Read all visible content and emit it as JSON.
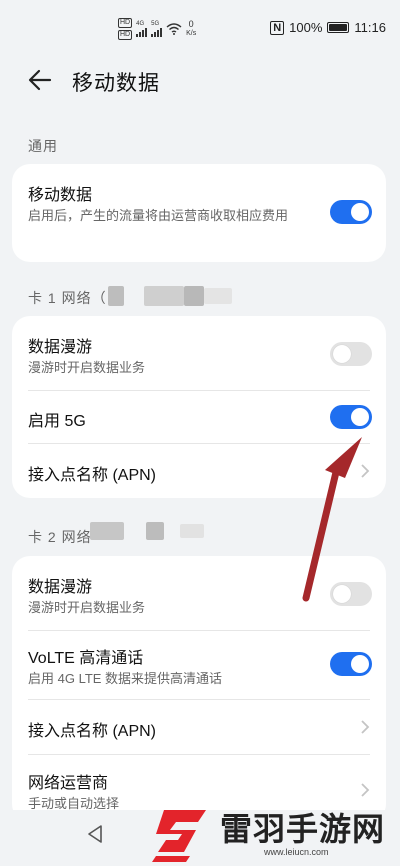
{
  "status_bar": {
    "speed_value": "0",
    "speed_unit": "K/s",
    "battery_percent": "100%",
    "time": "11:16",
    "network_types": [
      "HD",
      "HD",
      "4G",
      "5G"
    ]
  },
  "header": {
    "title": "移动数据"
  },
  "sections": {
    "general_label": "通用",
    "sim1_label": "卡 1 网络（",
    "sim2_label": "卡 2 网络"
  },
  "general_card": {
    "mobile_data": {
      "title": "移动数据",
      "subtitle": "启用后，产生的流量将由运营商收取相应费用",
      "enabled": true
    }
  },
  "sim1_card": {
    "data_roaming": {
      "title": "数据漫游",
      "subtitle": "漫游时开启数据业务",
      "enabled": false
    },
    "enable_5g": {
      "title": "启用 5G",
      "enabled": true
    },
    "apn": {
      "title": "接入点名称 (APN)"
    }
  },
  "sim2_card": {
    "data_roaming": {
      "title": "数据漫游",
      "subtitle": "漫游时开启数据业务",
      "enabled": false
    },
    "volte": {
      "title": "VoLTE 高清通话",
      "subtitle": "启用 4G LTE 数据来提供高清通话",
      "enabled": true
    },
    "apn": {
      "title": "接入点名称 (APN)"
    },
    "carrier": {
      "title": "网络运营商",
      "subtitle": "手动或自动选择"
    }
  },
  "watermark": {
    "text": "雷羽手游网",
    "url": "www.leiucn.com"
  },
  "colors": {
    "accent": "#1f6ff0",
    "annotation_arrow": "#a5282b",
    "background": "#f1f3f5"
  }
}
